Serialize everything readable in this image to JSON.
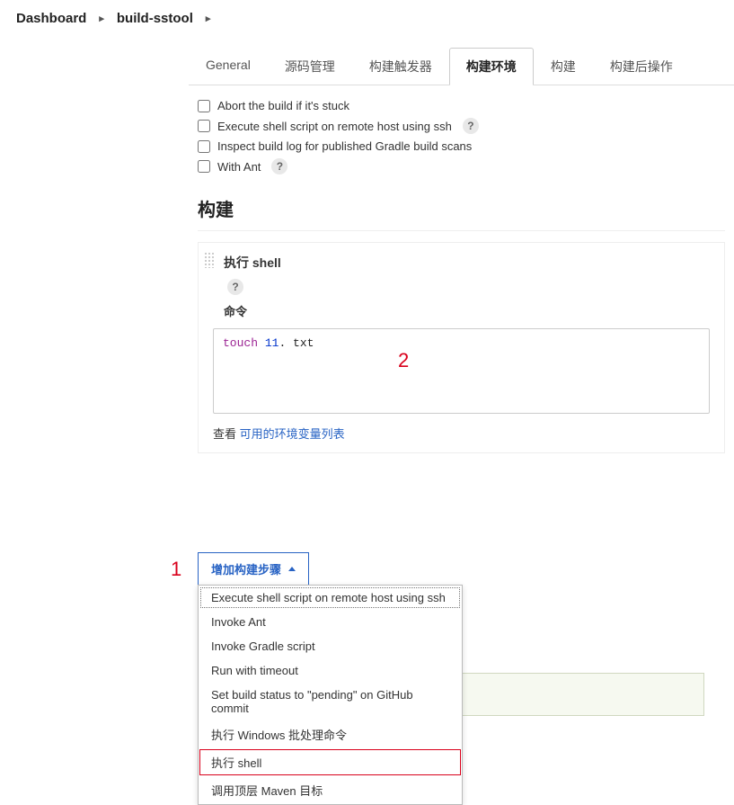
{
  "breadcrumb": {
    "items": [
      "Dashboard",
      "build-sstool"
    ]
  },
  "tabs": [
    {
      "label": "General"
    },
    {
      "label": "源码管理"
    },
    {
      "label": "构建触发器"
    },
    {
      "label": "构建环境",
      "active": true
    },
    {
      "label": "构建"
    },
    {
      "label": "构建后操作"
    }
  ],
  "build_env": {
    "checks": [
      {
        "label": "Abort the build if it's stuck",
        "help": false
      },
      {
        "label": "Execute shell script on remote host using ssh",
        "help": true
      },
      {
        "label": "Inspect build log for published Gradle build scans",
        "help": false
      },
      {
        "label": "With Ant",
        "help": true
      }
    ]
  },
  "build_section": {
    "title": "构建",
    "step": {
      "title": "执行 shell",
      "command_label": "命令",
      "command_keyword": "touch",
      "command_arg_num": "11",
      "command_arg_suffix": ". txt",
      "env_prefix": "查看 ",
      "env_link": "可用的环境变量列表"
    }
  },
  "add_step": {
    "button_label": "增加构建步骤",
    "options": [
      "Execute shell script on remote host using ssh",
      "Invoke Ant",
      "Invoke Gradle script",
      "Run with timeout",
      "Set build status to \"pending\" on GitHub commit",
      "执行 Windows 批处理命令",
      "执行 shell",
      "调用顶层 Maven 目标"
    ],
    "highlight_index": 6
  },
  "annotations": {
    "one": "1",
    "two": "2"
  },
  "footer": {
    "save": "",
    "other": ""
  }
}
